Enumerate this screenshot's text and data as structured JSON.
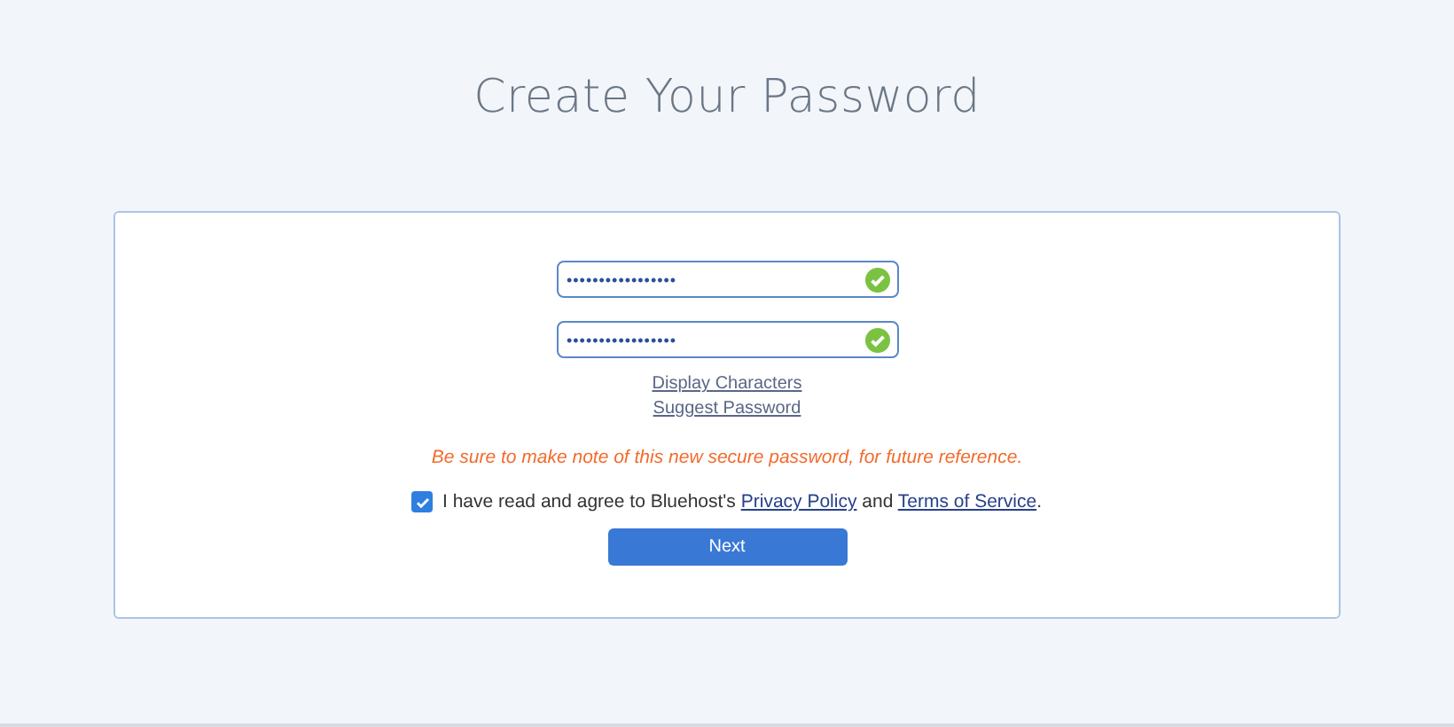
{
  "title": "Create Your Password",
  "password_fields": [
    {
      "value": "•••••••••••••••••",
      "valid": true
    },
    {
      "value": "•••••••••••••••••",
      "valid": true
    }
  ],
  "links": [
    "Display Characters",
    "Suggest Password"
  ],
  "note": "Be sure to make note of this new secure password, for future reference.",
  "agreement": {
    "checked": true,
    "text_before": "I have read and agree to Bluehost's ",
    "privacy_link": "Privacy Policy",
    "text_between": " and ",
    "terms_link": "Terms of Service",
    "text_after": "."
  },
  "next_button": "Next"
}
